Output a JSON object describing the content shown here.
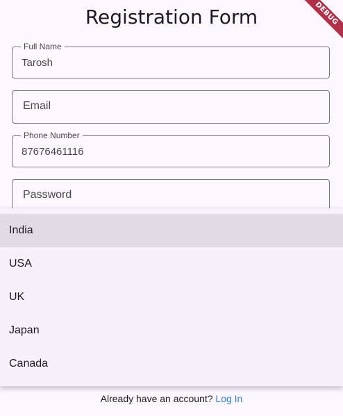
{
  "header": {
    "title": "Registration Form",
    "debug_banner": "DEBUG"
  },
  "form": {
    "full_name": {
      "label": "Full Name",
      "value": "Tarosh"
    },
    "email": {
      "placeholder": "Email"
    },
    "phone": {
      "label": "Phone Number",
      "value": "87676461116"
    },
    "password": {
      "placeholder": "Password"
    }
  },
  "country_dropdown": {
    "selected": "India",
    "options": [
      "India",
      "USA",
      "UK",
      "Japan",
      "Canada"
    ]
  },
  "footer": {
    "prompt": "Already have an account?",
    "link": "Log In"
  },
  "colors": {
    "background": "#fdf7ff",
    "menu_background": "#f7f2fa",
    "selected_item": "#e0dce3",
    "link": "#2e7fd1",
    "debug_ribbon": "#b1314a"
  }
}
